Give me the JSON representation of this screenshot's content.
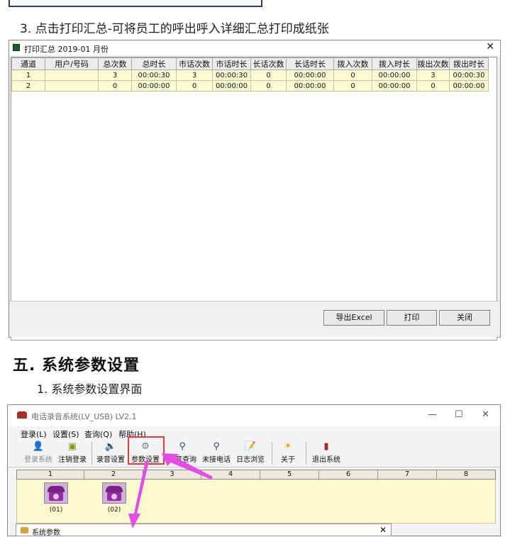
{
  "step3_caption": "3. 点击打印汇总-可将员工的呼出呼入详细汇总打印成纸张",
  "summary_dialog": {
    "title": "打印汇总 2019-01 月份",
    "columns": [
      "通道",
      "用户/号码",
      "总次数",
      "总时长",
      "市话次数",
      "市话时长",
      "长话次数",
      "长话时长",
      "拨入次数",
      "拨入时长",
      "拨出次数",
      "拨出时长"
    ],
    "rows": [
      [
        "1",
        "",
        "3",
        "00:00:30",
        "3",
        "00:00:30",
        "0",
        "00:00:00",
        "0",
        "00:00:00",
        "3",
        "00:00:30"
      ],
      [
        "2",
        "",
        "0",
        "00:00:00",
        "0",
        "00:00:00",
        "0",
        "00:00:00",
        "0",
        "00:00:00",
        "0",
        "00:00:00"
      ]
    ],
    "buttons": {
      "export": "导出Excel",
      "print": "打印",
      "close": "关闭"
    }
  },
  "section_heading": "五. 系统参数设置",
  "subheading": "1. 系统参数设置界面",
  "app_window": {
    "title": "电话录音系统(LV_USB) LV2.1",
    "menu": [
      "登录(L)",
      "设置(S)",
      "查询(Q)",
      "帮助(H)"
    ],
    "toolbar": [
      {
        "label": "登录系统",
        "icon": "user-icon"
      },
      {
        "label": "注销登录",
        "icon": "key-icon"
      },
      {
        "label": "录音设置",
        "icon": "speaker-icon"
      },
      {
        "label": "参数设置",
        "icon": "gear-icon"
      },
      {
        "label": "录音查询",
        "icon": "search-icon"
      },
      {
        "label": "未接电话",
        "icon": "search-icon"
      },
      {
        "label": "日志浏览",
        "icon": "log-icon"
      },
      {
        "label": "关于",
        "icon": "bulb-icon"
      },
      {
        "label": "退出系统",
        "icon": "exit-icon"
      }
    ],
    "channel_headers": [
      "1",
      "2",
      "3",
      "4",
      "5",
      "6",
      "7",
      "8"
    ],
    "phones": [
      "(01)",
      "(02)"
    ]
  },
  "params_dialog_title": "系统参数",
  "colors": {
    "highlight": "#e33b3b",
    "arrow": "#e24de6",
    "row_bg": "#fefcd5"
  }
}
